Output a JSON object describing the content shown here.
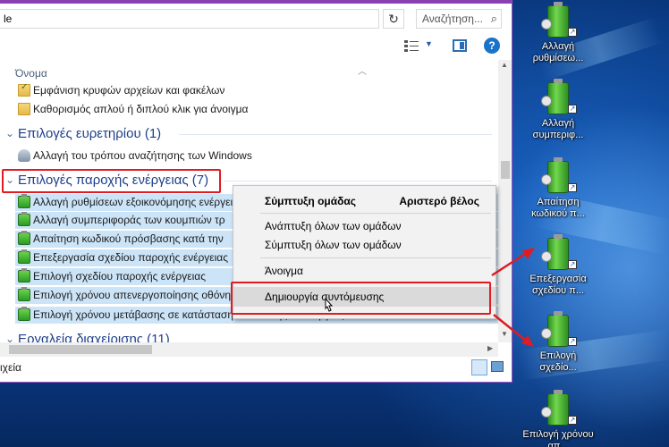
{
  "address": {
    "text": "le"
  },
  "search": {
    "placeholder": "Αναζήτηση..."
  },
  "content": {
    "column_header": "Όνομα",
    "top_items": [
      "Εμφάνιση κρυφών αρχείων και φακέλων",
      "Καθορισμός απλού ή διπλού κλικ για άνοιγμα"
    ],
    "groups": [
      {
        "title": "Επιλογές ευρετηρίου (1)",
        "items": [
          "Αλλαγή του τρόπου αναζήτησης των Windows"
        ]
      },
      {
        "title": "Επιλογές παροχής ενέργειας (7)",
        "items": [
          "Αλλαγή ρυθμίσεων εξοικονόμησης ενέργει",
          "Αλλαγή συμπεριφοράς των κουμπιών τρ",
          "Απαίτηση κωδικού πρόσβασης κατά την",
          "Επεξεργασία σχεδίου παροχής ενέργειας",
          "Επιλογή σχεδίου παροχής ενέργειας",
          "Επιλογή χρόνου απενεργοποίησης οθόνη",
          "Επιλογή χρόνου μετάβασης σε κατάσταση αναστολής λειτουργίας"
        ]
      },
      {
        "title": "Εργαλεία διαχείρισης (11)"
      }
    ]
  },
  "status": {
    "text": "ιχεία"
  },
  "context_menu": {
    "items": [
      {
        "label": "Σύμπτυξη ομάδας",
        "shortcut": "Αριστερό βέλος"
      },
      {
        "label": "Ανάπτυξη όλων των ομάδων"
      },
      {
        "label": "Σύμπτυξη όλων των ομάδων"
      },
      {
        "label": "Άνοιγμα"
      },
      {
        "label": "Δημιουργία συντόμευσης"
      }
    ]
  },
  "desktop_icons": [
    {
      "label": "Αλλαγή ρυθμίσεω..."
    },
    {
      "label": "Αλλαγή συμπεριφ..."
    },
    {
      "label": "Απαίτηση κωδικού π..."
    },
    {
      "label": "Επεξεργασία σχεδίου π..."
    },
    {
      "label": "Επιλογή σχεδίο..."
    },
    {
      "label": "Επιλογή χρόνου απ..."
    }
  ],
  "colors": {
    "highlight_red": "#e01b22",
    "selection_blue": "#cce4f7",
    "group_title": "#1e3f8a",
    "window_border": "#9b4fc2"
  }
}
